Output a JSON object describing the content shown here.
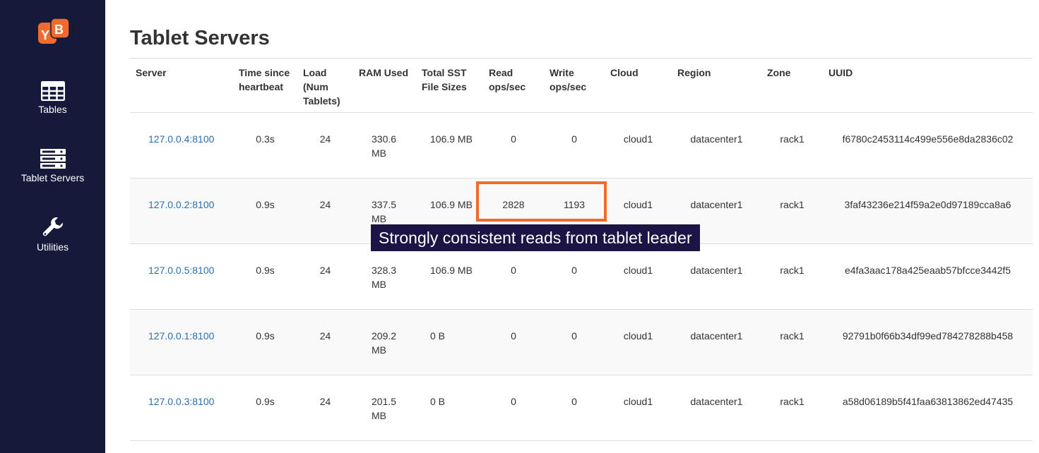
{
  "colors": {
    "sidebar_bg": "#151a3a",
    "link": "#2a6fb0",
    "highlight": "#f26b2e",
    "tooltip_bg": "#1c1445",
    "logo": "#f26b2e"
  },
  "logo": {
    "text": "YB"
  },
  "sidebar": {
    "items": [
      {
        "label": "Tables",
        "icon": "table-grid-icon"
      },
      {
        "label": "Tablet Servers",
        "icon": "server-stack-icon"
      },
      {
        "label": "Utilities",
        "icon": "wrench-icon"
      }
    ]
  },
  "page": {
    "title": "Tablet Servers"
  },
  "table": {
    "headers": {
      "server": "Server",
      "heartbeat": "Time since heartbeat",
      "load": "Load (Num Tablets)",
      "ram": "RAM Used",
      "sst": "Total SST File Sizes",
      "read": "Read ops/sec",
      "write": "Write ops/sec",
      "cloud": "Cloud",
      "region": "Region",
      "zone": "Zone",
      "uuid": "UUID"
    },
    "rows": [
      {
        "server": "127.0.0.4:8100",
        "heartbeat": "0.3s",
        "load": "24",
        "ram": "330.6 MB",
        "sst": "106.9 MB",
        "read": "0",
        "write": "0",
        "cloud": "cloud1",
        "region": "datacenter1",
        "zone": "rack1",
        "uuid": "f6780c2453114c499e556e8da2836c02"
      },
      {
        "server": "127.0.0.2:8100",
        "heartbeat": "0.9s",
        "load": "24",
        "ram": "337.5 MB",
        "sst": "106.9 MB",
        "read": "2828",
        "write": "1193",
        "cloud": "cloud1",
        "region": "datacenter1",
        "zone": "rack1",
        "uuid": "3faf43236e214f59a2e0d97189cca8a6"
      },
      {
        "server": "127.0.0.5:8100",
        "heartbeat": "0.9s",
        "load": "24",
        "ram": "328.3 MB",
        "sst": "106.9 MB",
        "read": "0",
        "write": "0",
        "cloud": "cloud1",
        "region": "datacenter1",
        "zone": "rack1",
        "uuid": "e4fa3aac178a425eaab57bfcce3442f5"
      },
      {
        "server": "127.0.0.1:8100",
        "heartbeat": "0.9s",
        "load": "24",
        "ram": "209.2 MB",
        "sst": "0 B",
        "read": "0",
        "write": "0",
        "cloud": "cloud1",
        "region": "datacenter1",
        "zone": "rack1",
        "uuid": "92791b0f66b34df99ed784278288b458"
      },
      {
        "server": "127.0.0.3:8100",
        "heartbeat": "0.9s",
        "load": "24",
        "ram": "201.5 MB",
        "sst": "0 B",
        "read": "0",
        "write": "0",
        "cloud": "cloud1",
        "region": "datacenter1",
        "zone": "rack1",
        "uuid": "a58d06189b5f41faa63813862ed47435"
      }
    ]
  },
  "annotation": {
    "text": "Strongly consistent reads from tablet leader"
  }
}
